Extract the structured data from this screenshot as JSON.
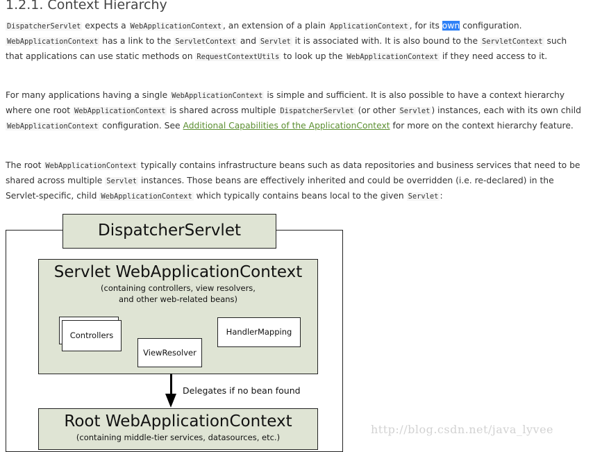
{
  "heading": "1.2.1. Context Hierarchy",
  "p1": {
    "c1": "DispatcherServlet",
    "t1": " expects a ",
    "c2": "WebApplicationContext",
    "t2": ", an extension of a plain ",
    "c3": "ApplicationContext",
    "t3": ", for its ",
    "highlight": "own",
    "t4": " configuration. ",
    "c4": "WebApplicationContext",
    "t5": " has a link to the ",
    "c5": "ServletContext",
    "t6": " and ",
    "c6": "Servlet",
    "t7": " it is associated with. It is also bound to the ",
    "c7": "ServletContext",
    "t8": " such that applications can use static methods on ",
    "c8": "RequestContextUtils",
    "t9": " to look up the ",
    "c9": "WebApplicationContext",
    "t10": " if they need access to it."
  },
  "p2": {
    "t1": "For many applications having a single ",
    "c1": "WebApplicationContext",
    "t2": " is simple and sufficient. It is also possible to have a context hierarchy where one root ",
    "c2": "WebApplicationContext",
    "t3": " is shared across multiple ",
    "c3": "DispatcherServlet",
    "t4": " (or other ",
    "c4": "Servlet",
    "t5": ") instances, each with its own child ",
    "c5": "WebApplicationContext",
    "t6": " configuration. See ",
    "link": "Additional Capabilities of the ApplicationContext",
    "t7": " for more on the context hierarchy feature."
  },
  "p3": {
    "t1": "The root ",
    "c1": "WebApplicationContext",
    "t2": " typically contains infrastructure beans such as data repositories and business services that need to be shared across multiple ",
    "c2": "Servlet",
    "t3": " instances. Those beans are effectively inherited and could be overridden (i.e. re-declared) in the Servlet-specific, child ",
    "c3": "WebApplicationContext",
    "t4": " which typically contains beans local to the given ",
    "c4": "Servlet",
    "t5": ":"
  },
  "diagram": {
    "dispatcher": "DispatcherServlet",
    "servlet_ctx_title": "Servlet WebApplicationContext",
    "servlet_ctx_sub1": "(containing controllers, view resolvers,",
    "servlet_ctx_sub2": "and other web-related beans)",
    "controllers": "Controllers",
    "view_resolver": "ViewResolver",
    "handler_mapping": "HandlerMapping",
    "delegates": "Delegates if no bean found",
    "root_ctx_title": "Root WebApplicationContext",
    "root_ctx_sub": "(containing middle-tier services, datasources, etc.)"
  },
  "watermark": "http://blog.csdn.net/java_lyvee"
}
